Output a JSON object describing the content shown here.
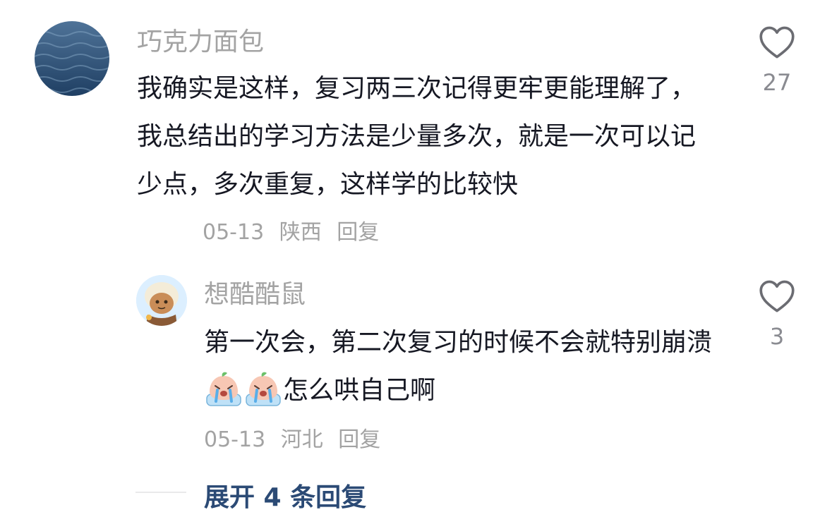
{
  "comments": [
    {
      "username": "巧克力面包",
      "avatar": "ocean-water-avatar",
      "text": "我确实是这样，复习两三次记得更牢更能理解了，我总结出的学习方法是少量多次，就是一次可以记少点，多次重复，这样学的比较快",
      "date": "05-13",
      "location": "陕西",
      "reply_label": "回复",
      "like_count": "27"
    }
  ],
  "replies": [
    {
      "username": "想酷酷鼠",
      "avatar": "cartoon-character-avatar",
      "text_before_emoji": "第一次会，第二次复习的时候不会就特别崩溃",
      "emojis": [
        "crying-peach-emoji",
        "crying-peach-emoji"
      ],
      "text_after_emoji": "怎么哄自己啊",
      "date": "05-13",
      "location": "河北",
      "reply_label": "回复",
      "like_count": "3"
    }
  ],
  "expand_replies_label": "展开 4 条回复",
  "colors": {
    "text": "#161823",
    "secondary": "#a3a3a3",
    "link": "#2b4a75"
  }
}
